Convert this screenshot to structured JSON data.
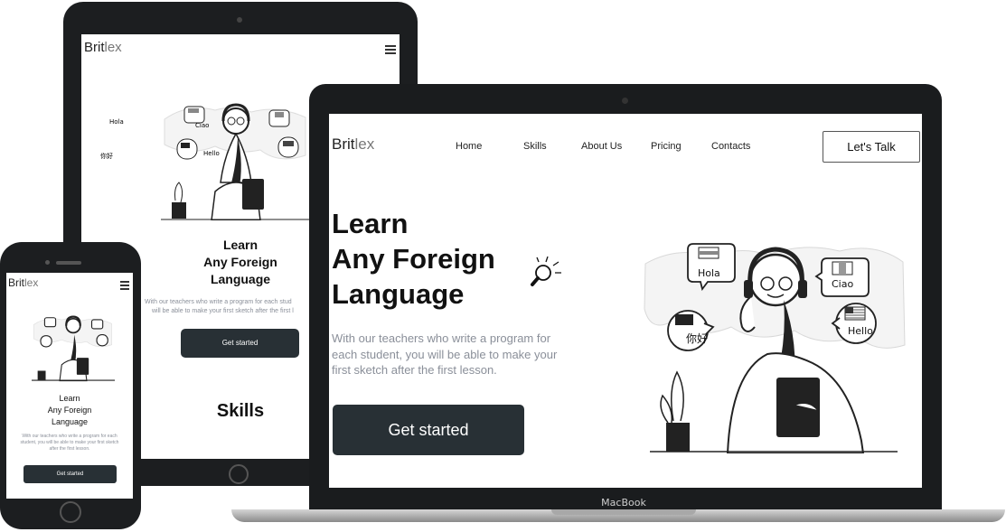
{
  "brand": {
    "part1": "Brit",
    "part2": "lex"
  },
  "nav": [
    "Home",
    "Skills",
    "About Us",
    "Pricing",
    "Contacts"
  ],
  "cta": "Let's Talk",
  "hero": {
    "line1": "Learn",
    "line2": "Any Foreign",
    "line3": "Language",
    "description_lines": [
      "With our teachers who write a program for",
      "each student, you will be able to make your",
      "first sketch after the first lesson."
    ],
    "button": "Get started"
  },
  "bubbles": {
    "hola": "Hola",
    "ciao": "Ciao",
    "hello": "Hello",
    "nihao": "你好"
  },
  "tablet": {
    "description_lines": [
      "With our teachers who write a program for each stud",
      "will be able to make your first sketch after the first l"
    ],
    "section_title": "Skills"
  },
  "phone": {
    "description_lines": [
      "With our teachers who write a program for each",
      "student, you will be able to make your first sketch",
      "after the first lesson."
    ]
  },
  "laptop_label": "MacBook",
  "colors": {
    "button": "#283035",
    "text": "#111111",
    "muted": "#8a8f99",
    "bezel": "#1c1e20"
  }
}
